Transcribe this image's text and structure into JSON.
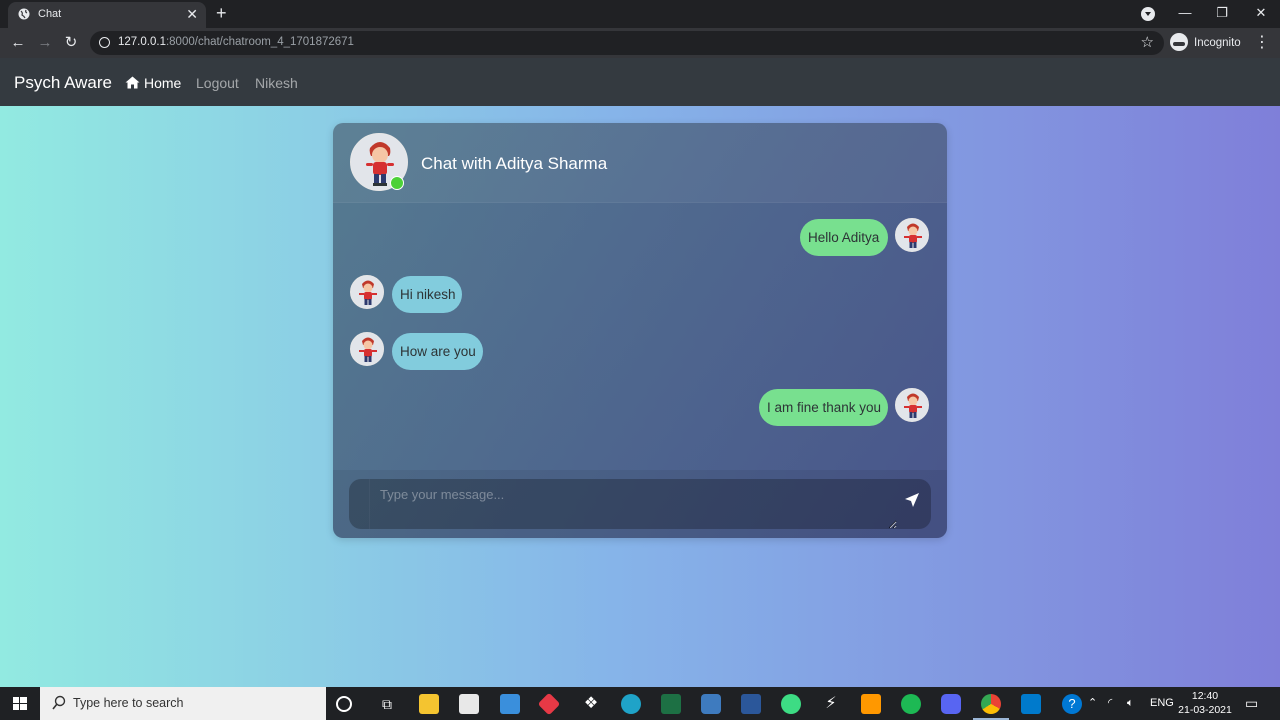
{
  "browser": {
    "tab_title": "Chat",
    "new_tab_symbol": "+",
    "url_host": "127.0.0.1",
    "url_rest": ":8000/chat/chatroom_4_1701872671",
    "incognito_label": "Incognito"
  },
  "navbar": {
    "brand": "Psych Aware",
    "links": {
      "home": "Home",
      "logout": "Logout",
      "user": "Nikesh"
    }
  },
  "chat": {
    "title": "Chat with Aditya Sharma",
    "contact_status": "online",
    "messages": [
      {
        "direction": "sent",
        "text": "Hello Aditya"
      },
      {
        "direction": "received",
        "text": "Hi nikesh"
      },
      {
        "direction": "received",
        "text": "How are you"
      },
      {
        "direction": "sent",
        "text": "I am fine thank you"
      }
    ],
    "input_placeholder": "Type your message..."
  },
  "taskbar": {
    "search_placeholder": "Type here to search",
    "language": "ENG",
    "time": "12:40",
    "date": "21-03-2021"
  },
  "colors": {
    "sent_bubble": "#78e08f",
    "received_bubble": "#82ccdd",
    "online_dot": "#4cd137",
    "navbar_bg": "#343a40"
  }
}
